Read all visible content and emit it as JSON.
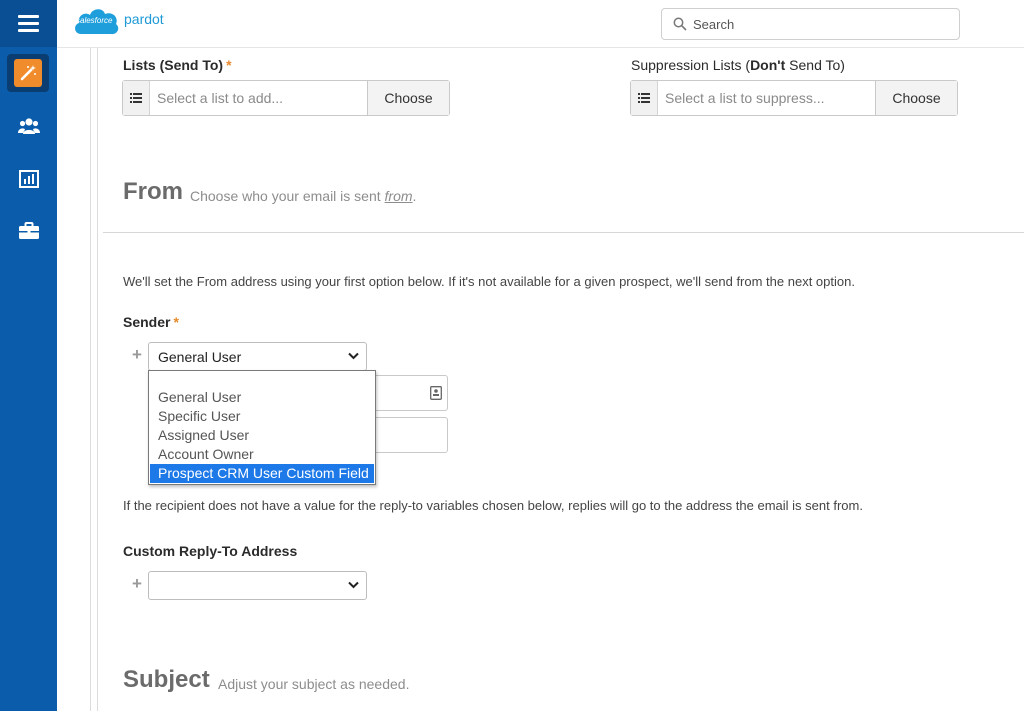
{
  "header": {
    "logo_word": "salesforce",
    "product": "pardot",
    "search_placeholder": "Search"
  },
  "nav": {
    "items": [
      {
        "name": "engagement-icon"
      },
      {
        "name": "prospects-icon"
      },
      {
        "name": "reports-icon"
      },
      {
        "name": "admin-icon"
      }
    ]
  },
  "lists": {
    "send_label": "Lists (Send To)",
    "required_mark": "*",
    "send_placeholder": "Select a list to add...",
    "choose_label": "Choose",
    "suppress_label_pre": "Suppression Lists (",
    "suppress_label_bold": "Don't",
    "suppress_label_post": " Send To)",
    "suppress_placeholder": "Select a list to suppress..."
  },
  "from": {
    "title": "From",
    "subtitle_pre": "Choose who your email is sent ",
    "subtitle_link": "from",
    "subtitle_post": ".",
    "help": "We'll set the From address using your first option below. If it's not available for a given prospect, we'll send from the next option.",
    "sender_label": "Sender",
    "sender_selected": "General User",
    "options": [
      "General User",
      "Specific User",
      "Assigned User",
      "Account Owner",
      "Prospect CRM User Custom Field"
    ],
    "highlighted_option": "Prospect CRM User Custom Field"
  },
  "reply": {
    "help": "If the recipient does not have a value for the reply-to variables chosen below, replies will go to the address the email is sent from.",
    "label": "Custom Reply-To Address",
    "selected": ""
  },
  "subject": {
    "title": "Subject",
    "subtitle": "Adjust your subject as needed."
  },
  "colors": {
    "nav": "#0b5cab",
    "active_tile": "#f08c2b",
    "highlight": "#1e79e8",
    "required": "#e8892b"
  }
}
